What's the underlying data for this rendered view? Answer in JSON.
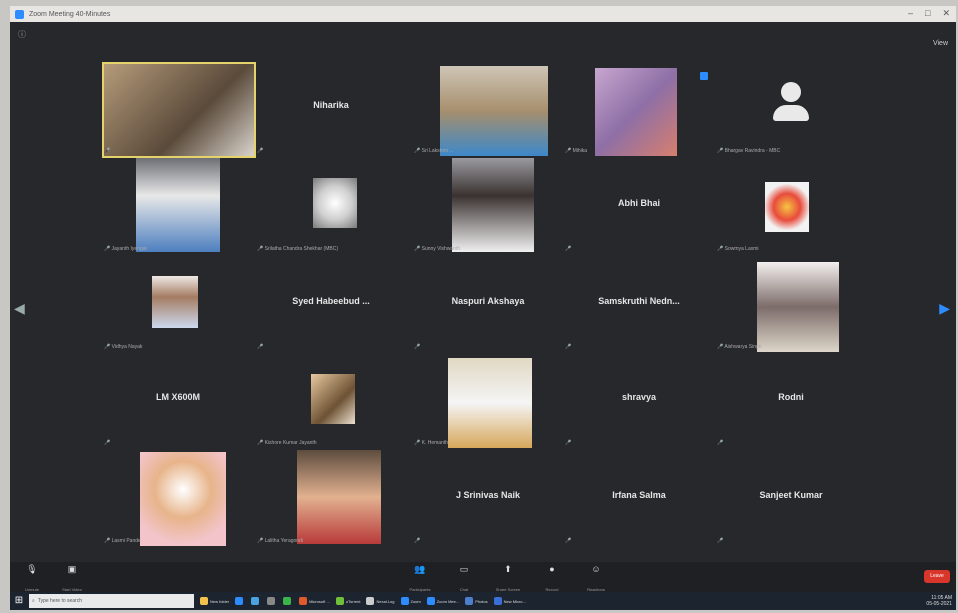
{
  "window": {
    "title": "Zoom Meeting 40-Minutes"
  },
  "controls": {
    "view_label": "View",
    "prev_arrow": "◀",
    "next_arrow": "▶"
  },
  "participants": [
    {
      "display": "",
      "label": "",
      "video": "person-with-sheets",
      "speaking": true
    },
    {
      "display": "Niharika",
      "label": ""
    },
    {
      "display": "",
      "label": "Sri Lakshmi ...",
      "video": "woman-in-blue"
    },
    {
      "display": "",
      "label": "Mihika",
      "video": "blurred-room"
    },
    {
      "display": "",
      "label": "Bhargav Ravindra - MBC",
      "video": "avatar"
    },
    {
      "display": "",
      "label": "Jayanth Iyengar",
      "video": "standing-man"
    },
    {
      "display": "",
      "label": "Srilatha Chandra Shekhar (MBC)",
      "video": "white-flower"
    },
    {
      "display": "",
      "label": "Sunny Vishwanth",
      "video": "young-man"
    },
    {
      "display": "Abhi Bhai",
      "label": ""
    },
    {
      "display": "",
      "label": "Sowmya Laxmi",
      "video": "cartoon-kid"
    },
    {
      "display": "",
      "label": "Vidhya Nayak",
      "video": "small-child"
    },
    {
      "display": "Syed Habeebud ...",
      "label": ""
    },
    {
      "display": "Naspuri Akshaya",
      "label": ""
    },
    {
      "display": "Samskruthi Nedn...",
      "label": ""
    },
    {
      "display": "",
      "label": "Aishwarya Singh",
      "video": "woman-sitting"
    },
    {
      "display": "LM X600M",
      "label": ""
    },
    {
      "display": "",
      "label": "Kishore Kumar Jayanth",
      "video": "pets"
    },
    {
      "display": "",
      "label": "K. Hemanth",
      "video": "man-seated"
    },
    {
      "display": "shravya",
      "label": ""
    },
    {
      "display": "Rodni",
      "label": ""
    },
    {
      "display": "",
      "label": "Lasmi Pande",
      "video": "teddy-bears"
    },
    {
      "display": "",
      "label": "Lalitha Yeragondi",
      "video": "baby"
    },
    {
      "display": "J Srinivas Naik",
      "label": ""
    },
    {
      "display": "Irfana Salma",
      "label": ""
    },
    {
      "display": "Sanjeet Kumar",
      "label": ""
    }
  ],
  "toolbar": {
    "items": [
      {
        "label": "Participants",
        "icon": "participants-icon",
        "glyph": "👥"
      },
      {
        "label": "Chat",
        "icon": "chat-icon",
        "glyph": "▭"
      },
      {
        "label": "Share Screen",
        "icon": "share-screen-icon",
        "glyph": "⬆"
      },
      {
        "label": "Record",
        "icon": "record-icon",
        "glyph": "●"
      },
      {
        "label": "Reactions",
        "icon": "reactions-icon",
        "glyph": "☺"
      }
    ],
    "left_items": [
      {
        "label": "Unmute",
        "icon": "microphone-icon",
        "glyph": "🎙"
      },
      {
        "label": "Start Video",
        "icon": "camera-icon",
        "glyph": "▣"
      }
    ],
    "end_label": "Leave"
  },
  "taskbar": {
    "search_placeholder": "Type here to search",
    "apps": [
      {
        "name": "New folder",
        "color": "#f2c14e"
      },
      {
        "name": "",
        "color": "#2d8cff"
      },
      {
        "name": "",
        "color": "#4aa3df"
      },
      {
        "name": "",
        "color": "#888888"
      },
      {
        "name": "",
        "color": "#3bb54a"
      },
      {
        "name": "Microsoft ...",
        "color": "#e05a2b"
      },
      {
        "name": "uTorrent",
        "color": "#6fbf3b"
      },
      {
        "name": "Nexal.Log",
        "color": "#cccccc"
      },
      {
        "name": "Zoom",
        "color": "#2d8cff"
      },
      {
        "name": "Zoom Mee...",
        "color": "#2d8cff"
      },
      {
        "name": "Photos",
        "color": "#4d7fcc"
      },
      {
        "name": "New Micro...",
        "color": "#3a6fd8"
      }
    ],
    "time": "11:05 AM",
    "date": "05-05-2021"
  }
}
